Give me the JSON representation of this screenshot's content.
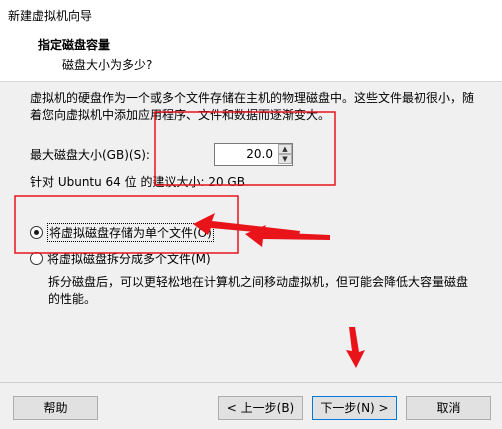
{
  "window": {
    "title": "新建虚拟机向导"
  },
  "header": {
    "title": "指定磁盘容量",
    "subtitle": "磁盘大小为多少?"
  },
  "description": "虚拟机的硬盘作为一个或多个文件存储在主机的物理磁盘中。这些文件最初很小，随着您向虚拟机中添加应用程序、文件和数据而逐渐变大。",
  "disk_size": {
    "label": "最大磁盘大小(GB)(S):",
    "value": "20.0"
  },
  "recommendation": "针对 Ubuntu 64 位 的建议大小: 20 GB",
  "options": {
    "single_file": {
      "label": "将虚拟磁盘存储为单个文件(O)",
      "checked": true
    },
    "multi_file": {
      "label": "将虚拟磁盘拆分成多个文件(M)",
      "checked": false
    }
  },
  "split_description": "拆分磁盘后，可以更轻松地在计算机之间移动虚拟机，但可能会降低大容量磁盘的性能。",
  "buttons": {
    "help": "帮助",
    "prev": "< 上一步(B)",
    "next": "下一步(N) >",
    "cancel": "取消"
  },
  "annotation_color": "#e8141a"
}
